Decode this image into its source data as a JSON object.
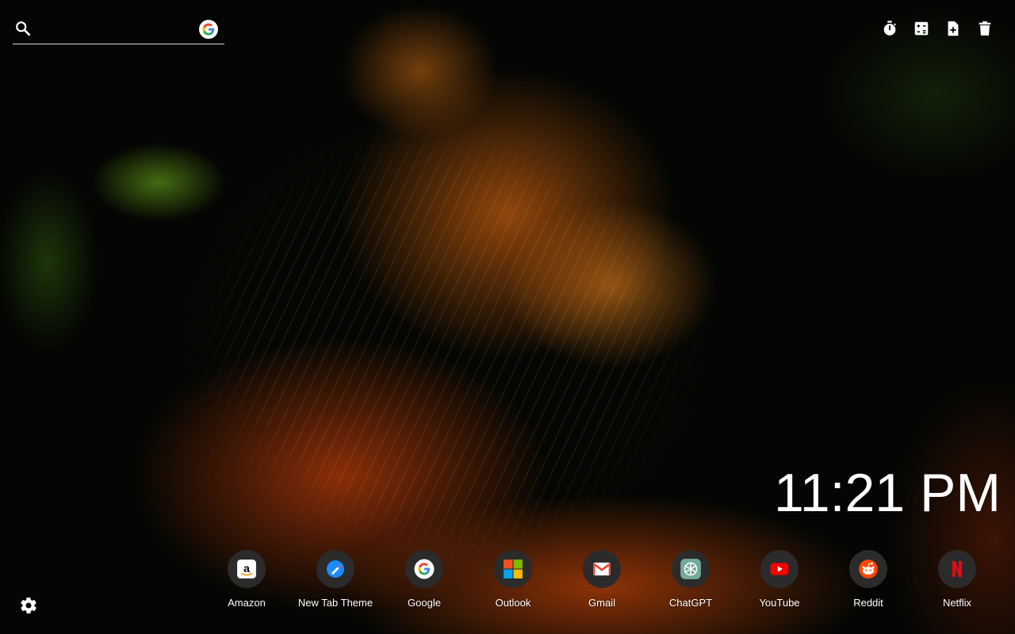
{
  "search": {
    "placeholder": "",
    "value": "",
    "engine_icon": "google-g-icon"
  },
  "tools": [
    {
      "name": "stopwatch-icon"
    },
    {
      "name": "calculator-icon"
    },
    {
      "name": "new-note-icon"
    },
    {
      "name": "trash-icon"
    }
  ],
  "clock": {
    "time": "11:21 PM"
  },
  "shortcuts": [
    {
      "label": "Amazon",
      "icon": "amazon-icon"
    },
    {
      "label": "New Tab Theme",
      "icon": "new-tab-theme-icon"
    },
    {
      "label": "Google",
      "icon": "google-icon"
    },
    {
      "label": "Outlook",
      "icon": "outlook-icon"
    },
    {
      "label": "Gmail",
      "icon": "gmail-icon"
    },
    {
      "label": "ChatGPT",
      "icon": "chatgpt-icon"
    },
    {
      "label": "YouTube",
      "icon": "youtube-icon"
    },
    {
      "label": "Reddit",
      "icon": "reddit-icon"
    },
    {
      "label": "Netflix",
      "icon": "netflix-icon"
    }
  ],
  "settings": {
    "icon": "gear-icon"
  },
  "colors": {
    "google_blue": "#4285F4",
    "google_red": "#EA4335",
    "google_yellow": "#FBBC05",
    "google_green": "#34A853",
    "youtube_red": "#FF0000",
    "reddit_orange": "#FF4500",
    "netflix_red": "#E50914",
    "shortcut_bg": "#2b2b2b"
  }
}
